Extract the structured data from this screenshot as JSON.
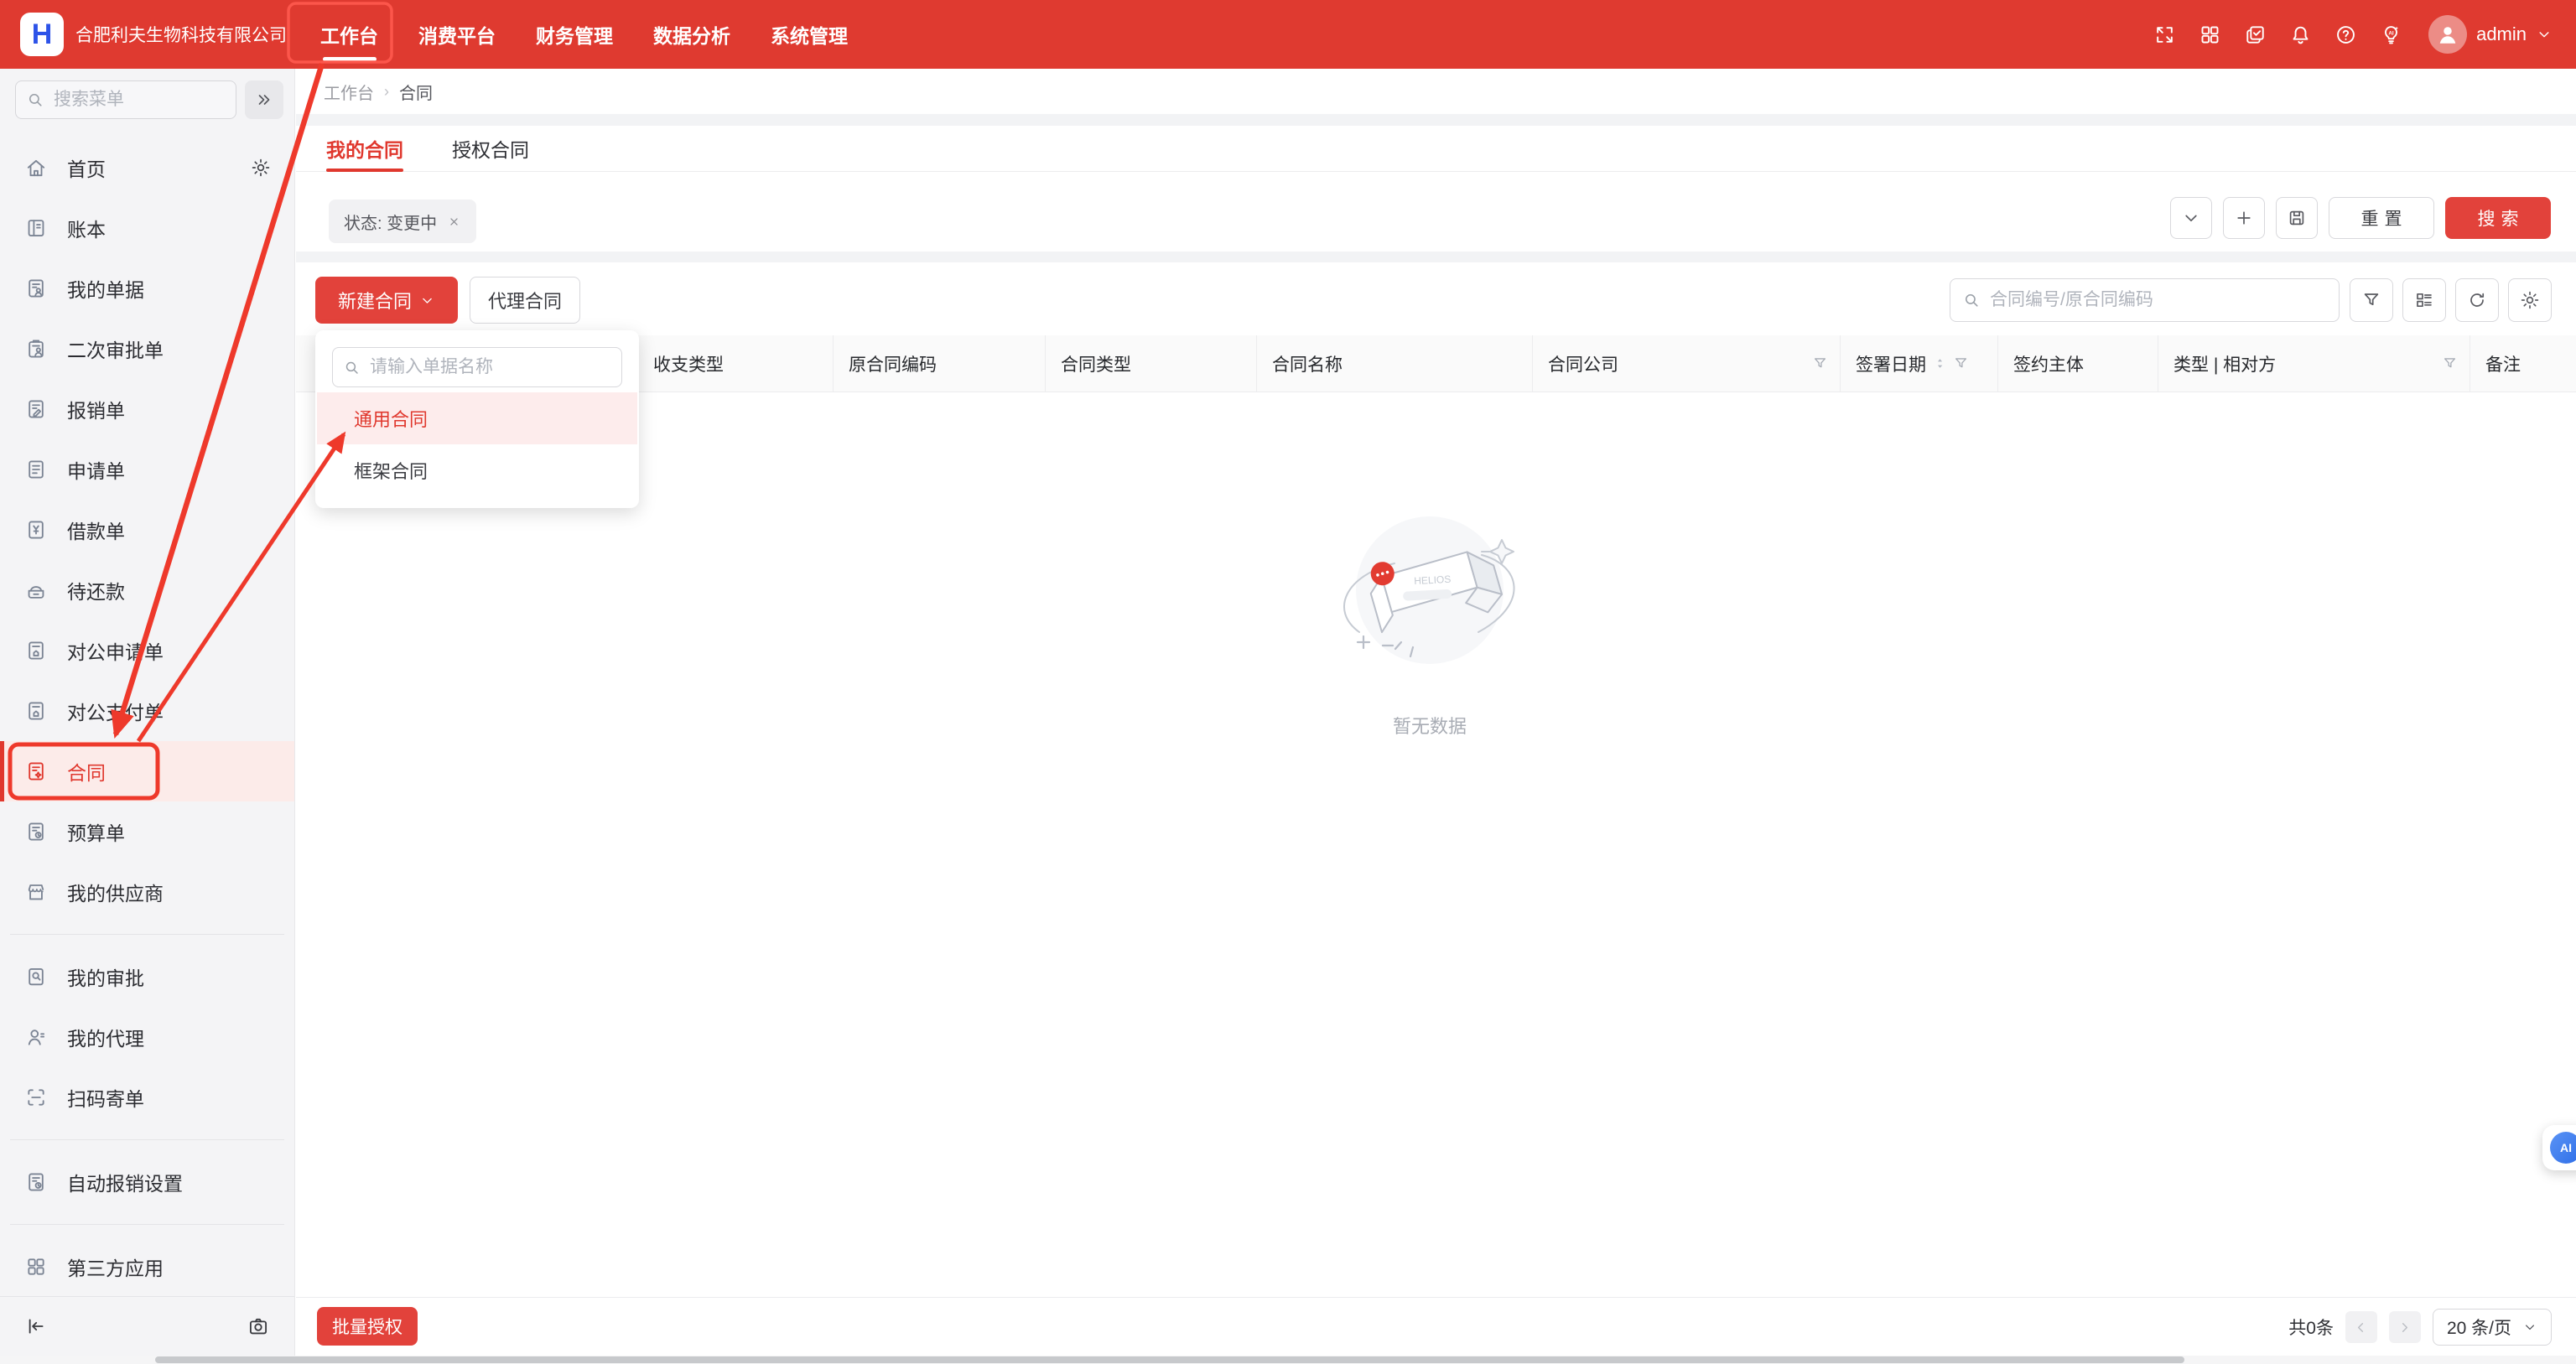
{
  "theme": {
    "topbar_red": "#df3a30",
    "button_red": "#e2423b",
    "accent_red": "#e0382e",
    "annotation_red": "#ee392b",
    "sidebar_active_bg": "#fcebe9"
  },
  "topbar": {
    "logo_letter": "H",
    "company": "合肥利夫生物科技有限公司",
    "nav": [
      {
        "label": "工作台",
        "active": true
      },
      {
        "label": "消费平台"
      },
      {
        "label": "财务管理"
      },
      {
        "label": "数据分析"
      },
      {
        "label": "系统管理"
      }
    ],
    "icons": [
      "fullscreen",
      "apps-grid",
      "copy-check",
      "bell",
      "question",
      "ai-bulb"
    ],
    "user": {
      "name": "admin"
    }
  },
  "sidebar": {
    "search_placeholder": "搜索菜单",
    "items": [
      {
        "key": "home",
        "icon": "home",
        "label": "首页",
        "gear": true
      },
      {
        "key": "ledger",
        "icon": "book",
        "label": "账本"
      },
      {
        "key": "my-documents",
        "icon": "doc-user",
        "label": "我的单据"
      },
      {
        "key": "second-approval",
        "icon": "clipboard-user",
        "label": "二次审批单"
      },
      {
        "key": "expense-form",
        "icon": "doc-edit",
        "label": "报销单"
      },
      {
        "key": "application-form",
        "icon": "doc",
        "label": "申请单"
      },
      {
        "key": "loan-form",
        "icon": "yen",
        "label": "借款单"
      },
      {
        "key": "pending-repayment",
        "icon": "repay",
        "label": "待还款"
      },
      {
        "key": "corporate-application",
        "icon": "doc-home",
        "label": "对公申请单"
      },
      {
        "key": "corporate-payment",
        "icon": "doc-home",
        "label": "对公支付单"
      },
      {
        "key": "contract",
        "icon": "doc-star",
        "label": "合同",
        "active": true
      },
      {
        "key": "budget-form",
        "icon": "doc-clock",
        "label": "预算单"
      },
      {
        "key": "my-suppliers",
        "icon": "store",
        "label": "我的供应商"
      },
      {
        "divider": true
      },
      {
        "key": "my-approvals",
        "icon": "doc-search",
        "label": "我的审批"
      },
      {
        "key": "my-agents",
        "icon": "user",
        "label": "我的代理"
      },
      {
        "key": "scan-send",
        "icon": "scan",
        "label": "扫码寄单"
      },
      {
        "divider": true
      },
      {
        "key": "auto-expense-settings",
        "icon": "doc-clock",
        "label": "自动报销设置"
      },
      {
        "divider": true
      },
      {
        "key": "third-party-apps",
        "icon": "grid",
        "label": "第三方应用"
      }
    ]
  },
  "breadcrumb": {
    "items": [
      "工作台",
      "合同"
    ],
    "separator": "›"
  },
  "tabs": [
    {
      "label": "我的合同",
      "active": true
    },
    {
      "label": "授权合同"
    }
  ],
  "filter_bar": {
    "tag": "状态: 变更中",
    "reset_label": "重置",
    "search_label": "搜索"
  },
  "toolbar": {
    "new_contract_label": "新建合同",
    "agent_contract_label": "代理合同",
    "search_placeholder": "合同编号/原合同编码"
  },
  "new_contract_menu": {
    "search_placeholder": "请输入单据名称",
    "options": [
      {
        "label": "通用合同",
        "highlighted": true
      },
      {
        "label": "框架合同"
      }
    ]
  },
  "table": {
    "columns": [
      {
        "label": ""
      },
      {
        "label": "收支类型"
      },
      {
        "label": "原合同编码"
      },
      {
        "label": "合同类型"
      },
      {
        "label": "合同名称"
      },
      {
        "label": "合同公司",
        "funnel": true
      },
      {
        "label": "签署日期",
        "sort": true,
        "funnel": true
      },
      {
        "label": "签约主体"
      },
      {
        "label": "类型 | 相对方",
        "funnel": true
      },
      {
        "label": "备注"
      }
    ]
  },
  "empty_state": {
    "text": "暂无数据",
    "brand": "HELIOS"
  },
  "footer": {
    "batch_label": "批量授权",
    "total": "共0条",
    "page_size": "20 条/页"
  },
  "ai_fab": {
    "label": "AI"
  }
}
